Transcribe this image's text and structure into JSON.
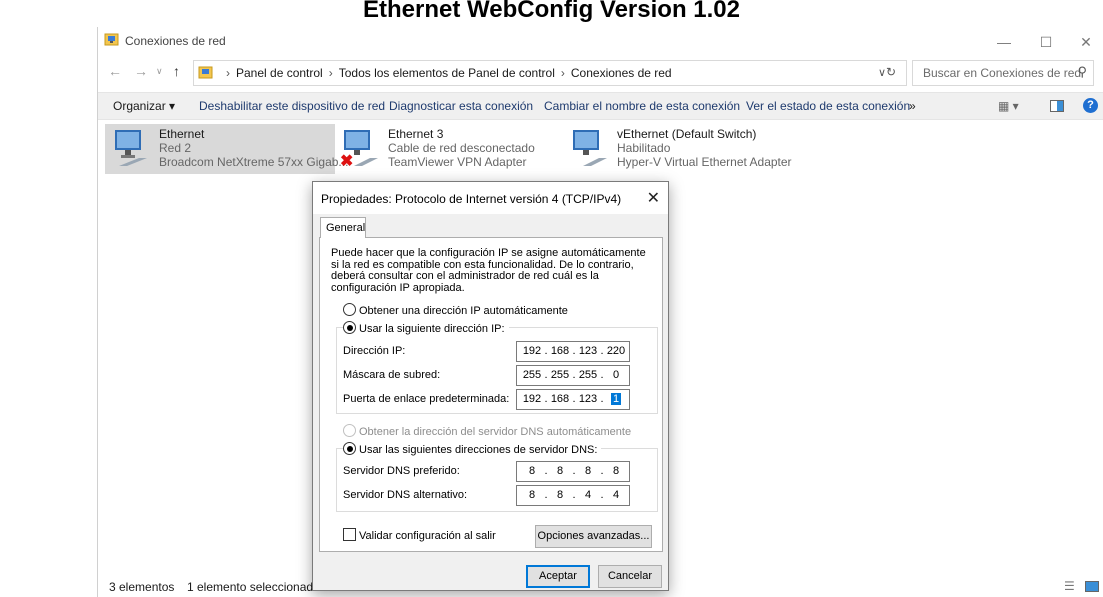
{
  "page_title": "Ethernet WebConfig Version 1.02",
  "window": {
    "title": "Conexiones de red",
    "minimize": "—",
    "maximize": "☐",
    "close": "✕"
  },
  "address": {
    "crumbs": [
      "Panel de control",
      "Todos los elementos de Panel de control",
      "Conexiones de red"
    ],
    "search_placeholder": "Buscar en Conexiones de red"
  },
  "commands": {
    "organize": "Organizar ▾",
    "disable": "Deshabilitar este dispositivo de red",
    "diagnose": "Diagnosticar esta conexión",
    "rename": "Cambiar el nombre de esta conexión",
    "status": "Ver el estado de esta conexión",
    "more": "»"
  },
  "connections": [
    {
      "name": "Ethernet",
      "status": "Red 2",
      "adapter": "Broadcom NetXtreme 57xx Gigab...",
      "selected": true,
      "disconnected": false
    },
    {
      "name": "Ethernet 3",
      "status": "Cable de red desconectado",
      "adapter": "TeamViewer VPN Adapter",
      "selected": false,
      "disconnected": true
    },
    {
      "name": "vEthernet (Default Switch)",
      "status": "Habilitado",
      "adapter": "Hyper-V Virtual Ethernet Adapter",
      "selected": false,
      "disconnected": false
    }
  ],
  "statusbar": {
    "count": "3 elementos",
    "selected": "1 elemento seleccionado"
  },
  "dialog": {
    "title": "Propiedades: Protocolo de Internet versión 4 (TCP/IPv4)",
    "tab": "General",
    "description": "Puede hacer que la configuración IP se asigne automáticamente si la red es compatible con esta funcionalidad. De lo contrario, deberá consultar con el administrador de red cuál es la configuración IP apropiada.",
    "ip_auto": "Obtener una dirección IP automáticamente",
    "ip_manual": "Usar la siguiente dirección IP:",
    "ip_label": "Dirección IP:",
    "ip_value": [
      "192",
      "168",
      "123",
      "220"
    ],
    "mask_label": "Máscara de subred:",
    "mask_value": [
      "255",
      "255",
      "255",
      "0"
    ],
    "gateway_label": "Puerta de enlace predeterminada:",
    "gateway_value": [
      "192",
      "168",
      "123",
      "1"
    ],
    "dns_auto": "Obtener la dirección del servidor DNS automáticamente",
    "dns_manual": "Usar las siguientes direcciones de servidor DNS:",
    "dns1_label": "Servidor DNS preferido:",
    "dns1_value": [
      "8",
      "8",
      "8",
      "8"
    ],
    "dns2_label": "Servidor DNS alternativo:",
    "dns2_value": [
      "8",
      "8",
      "4",
      "4"
    ],
    "validate": "Validar configuración al salir",
    "advanced": "Opciones avanzadas...",
    "ok": "Aceptar",
    "cancel": "Cancelar"
  },
  "colors": {
    "selection": "#d9d9d9",
    "accent": "#0078d7",
    "link": "#1e3a6e"
  }
}
